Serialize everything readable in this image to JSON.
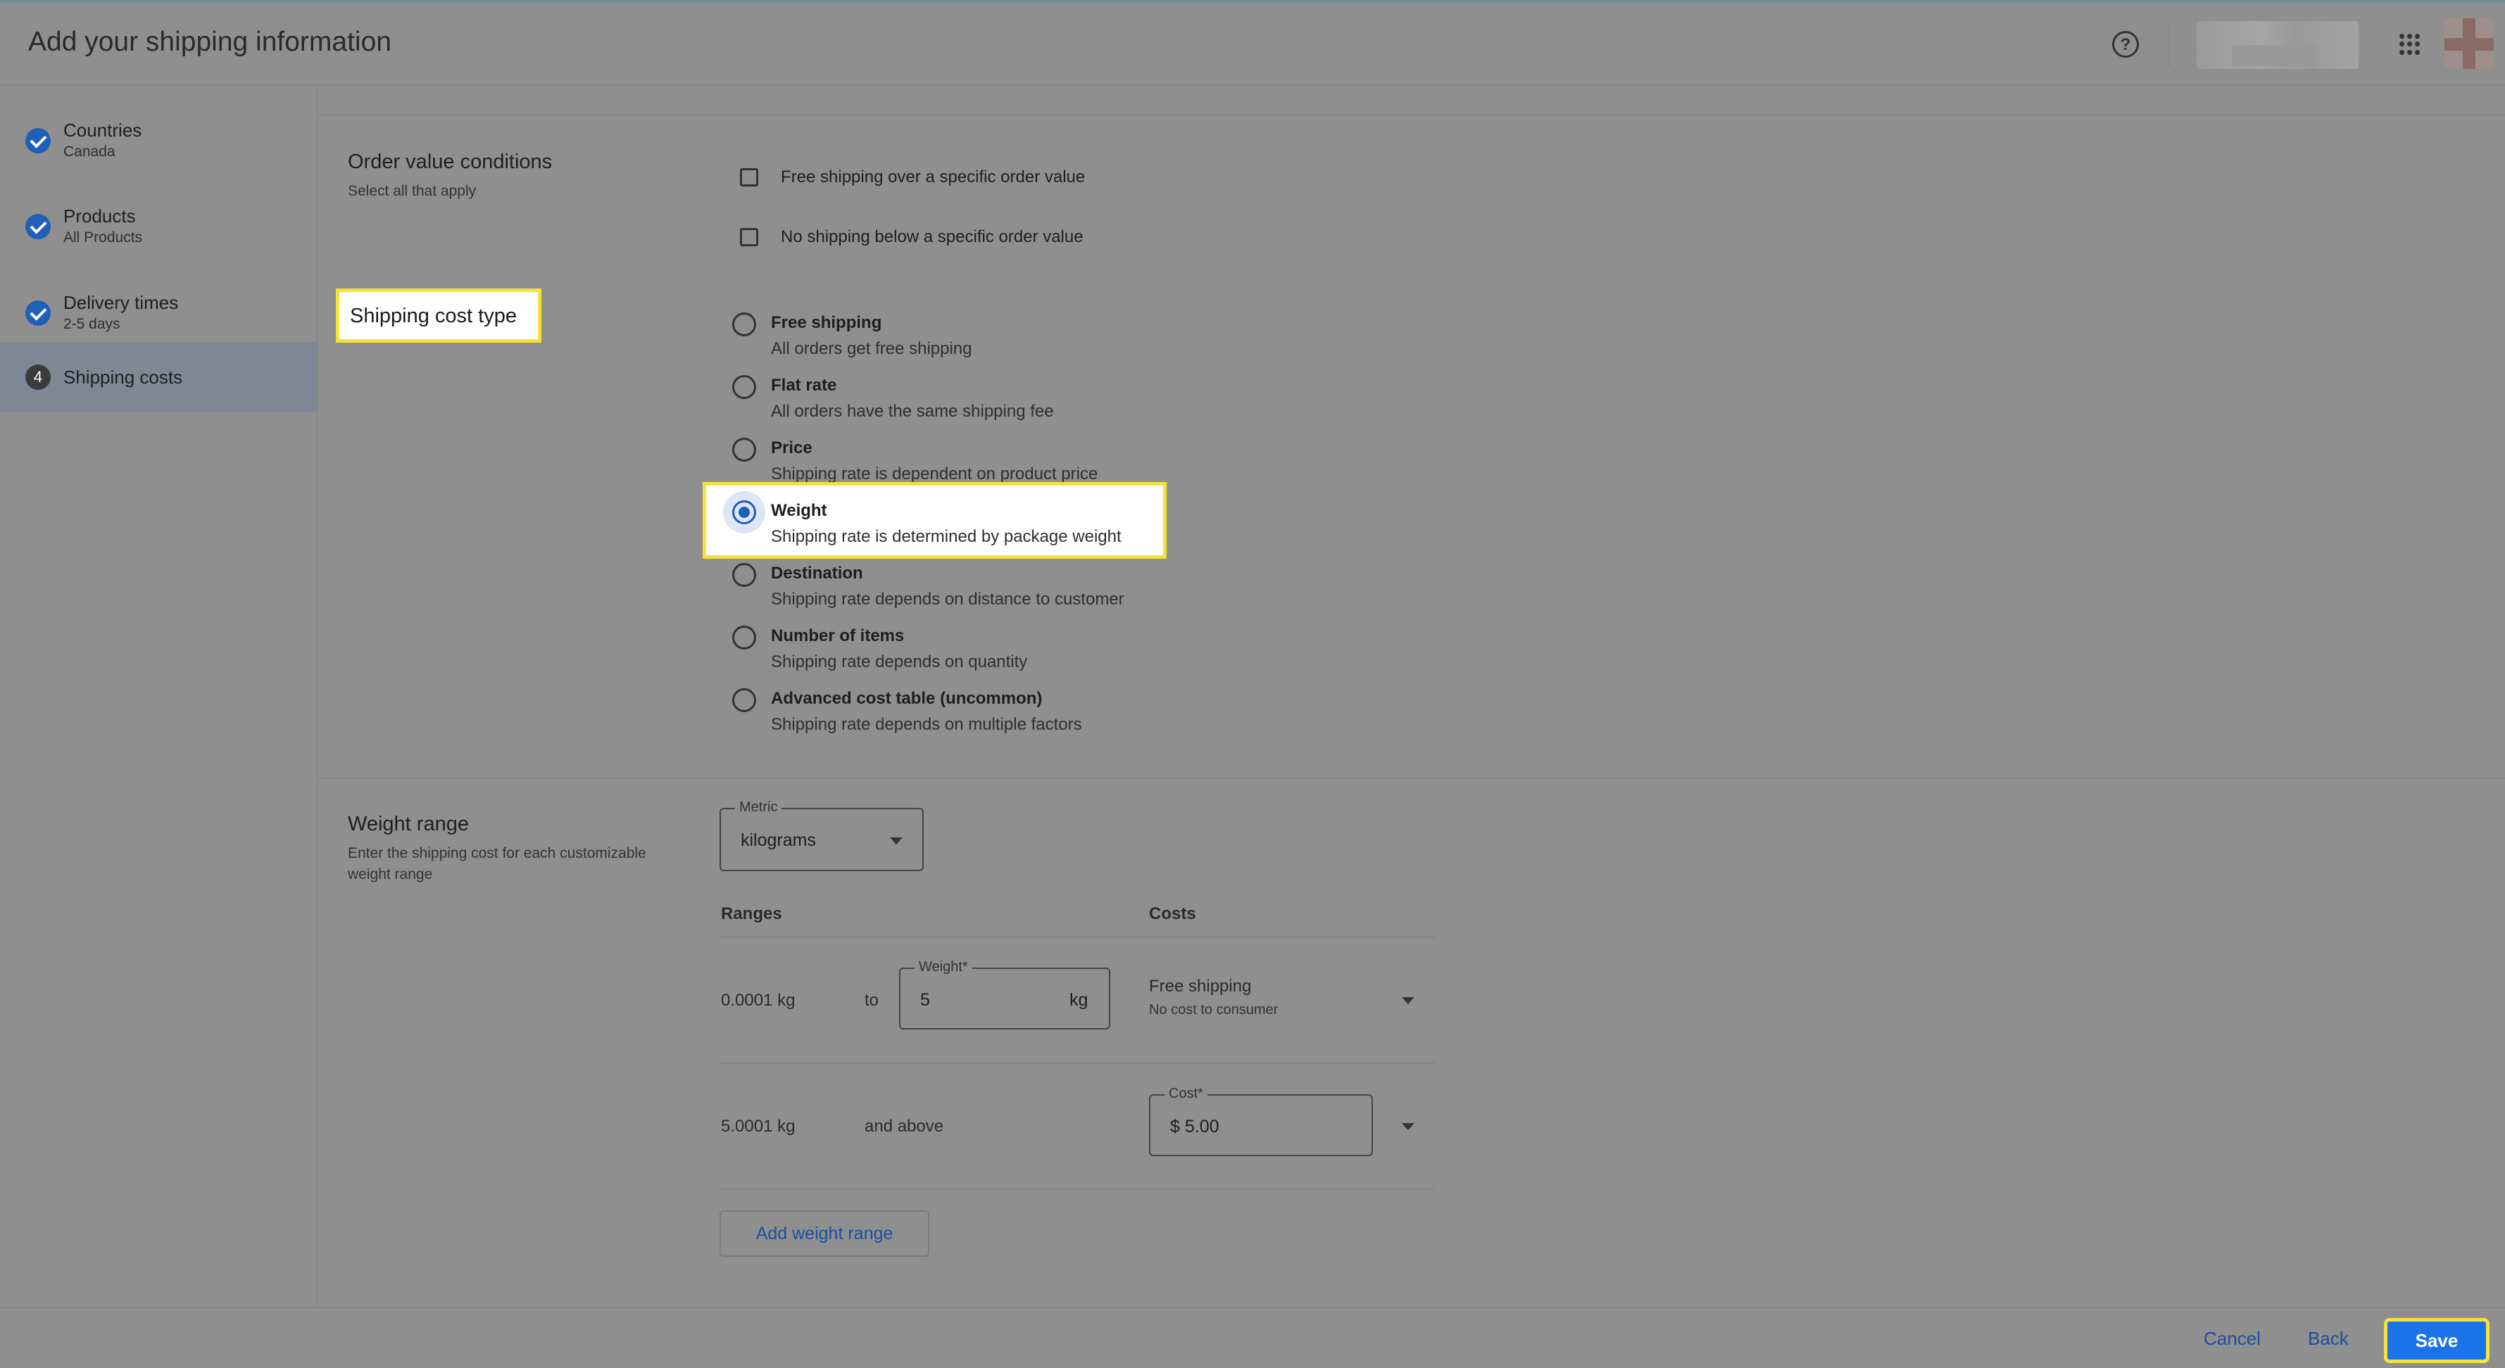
{
  "header": {
    "title": "Add your shipping information"
  },
  "sidebar": {
    "steps": [
      {
        "label": "Countries",
        "sub": "Canada"
      },
      {
        "label": "Products",
        "sub": "All Products"
      },
      {
        "label": "Delivery times",
        "sub": "2-5 days"
      },
      {
        "label": "Shipping costs",
        "number": "4"
      }
    ]
  },
  "order_value": {
    "title": "Order value conditions",
    "subtitle": "Select all that apply",
    "options": [
      {
        "label": "Free shipping over a specific order value",
        "checked": false
      },
      {
        "label": "No shipping below a specific order value",
        "checked": false
      }
    ]
  },
  "cost_type": {
    "title": "Shipping cost type",
    "selected": "Weight",
    "options": [
      {
        "label": "Free shipping",
        "sub": "All orders get free shipping"
      },
      {
        "label": "Flat rate",
        "sub": "All orders have the same shipping fee"
      },
      {
        "label": "Price",
        "sub": "Shipping rate is dependent on product price"
      },
      {
        "label": "Weight",
        "sub": "Shipping rate is determined by package weight"
      },
      {
        "label": "Destination",
        "sub": "Shipping rate depends on distance to customer"
      },
      {
        "label": "Number of items",
        "sub": "Shipping rate depends on quantity"
      },
      {
        "label": "Advanced cost table (uncommon)",
        "sub": "Shipping rate depends on multiple factors"
      }
    ]
  },
  "weight_range": {
    "title": "Weight range",
    "subtitle": "Enter the shipping cost for each customizable weight range",
    "metric_label": "Metric",
    "metric_value": "kilograms",
    "col_ranges": "Ranges",
    "col_costs": "Costs",
    "rows": [
      {
        "from": "0.0001 kg",
        "to_text": "to",
        "weight_label": "Weight*",
        "weight_value": "5",
        "unit": "kg",
        "cost_title": "Free shipping",
        "cost_sub": "No cost to consumer"
      },
      {
        "from": "5.0001 kg",
        "to_text": "and above",
        "cost_label": "Cost*",
        "cost_value": "$ 5.00"
      }
    ],
    "add_button": "Add weight range"
  },
  "footer": {
    "cancel": "Cancel",
    "back": "Back",
    "save": "Save"
  },
  "colors": {
    "accent": "#1a73e8",
    "highlight": "#f6e23a"
  }
}
